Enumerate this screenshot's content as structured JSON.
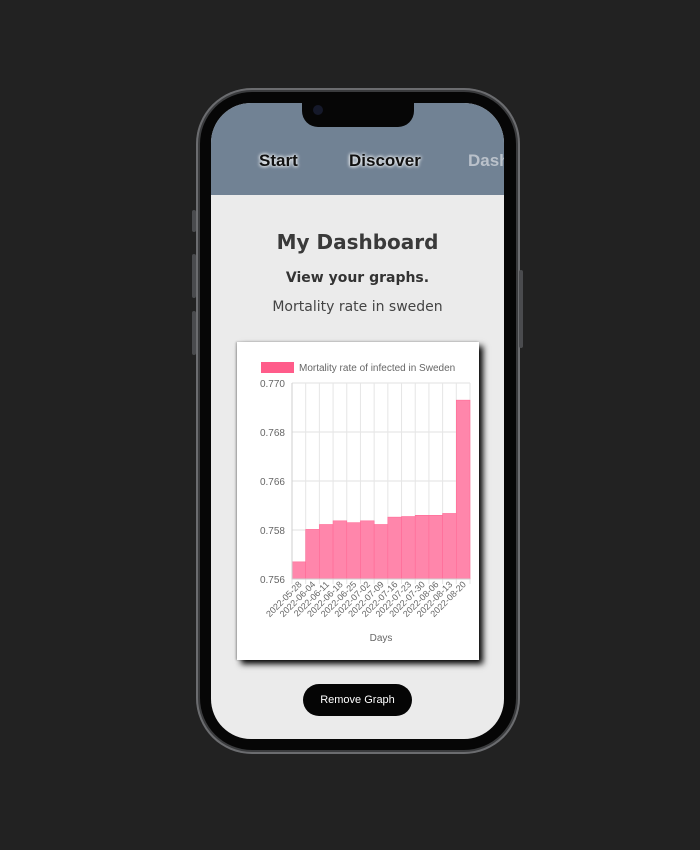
{
  "nav": {
    "items": [
      {
        "label": "Start"
      },
      {
        "label": "Discover"
      },
      {
        "label": "Dashboard"
      }
    ]
  },
  "main": {
    "title": "My Dashboard",
    "subtitle": "View your graphs.",
    "chart_name": "Mortality rate in sweden",
    "remove_button": "Remove Graph"
  },
  "colors": {
    "nav_bg": "#718294",
    "bar_fill": "#ff86ab",
    "bar_stroke": "#ff6a96",
    "legend": "#ff5c8a",
    "button_bg": "#050505"
  },
  "chart_data": {
    "type": "bar",
    "legend_position": "top",
    "grid": true,
    "xlabel": "Days",
    "ylabel": "",
    "ylim": [
      0.756,
      0.77
    ],
    "yticks": [
      "0.770",
      "0.768",
      "0.766",
      "0.758",
      "0.756"
    ],
    "x_tick_labels": [
      "2022-05-28",
      "2022-06-04",
      "2022-06-11",
      "2022-06-18",
      "2022-06-25",
      "2022-07-02",
      "2022-07-09",
      "2022-07-16",
      "2022-07-23",
      "2022-07-30",
      "2022-08-06",
      "2022-08-13",
      "2022-08-20"
    ],
    "categories": [
      "2022-05-28",
      "2022-06-04",
      "2022-06-11",
      "2022-06-18",
      "2022-06-25",
      "2022-07-02",
      "2022-07-09",
      "2022-07-16",
      "2022-07-23",
      "2022-07-30",
      "2022-08-06",
      "2022-08-13",
      "2022-08-20"
    ],
    "series": [
      {
        "name": "Mortality rate of infected in Sweden",
        "values": [
          0.7567,
          0.7581,
          0.7589,
          0.7595,
          0.7592,
          0.7595,
          0.7589,
          0.7601,
          0.7602,
          0.7604,
          0.7604,
          0.7607,
          0.7693
        ]
      }
    ]
  }
}
